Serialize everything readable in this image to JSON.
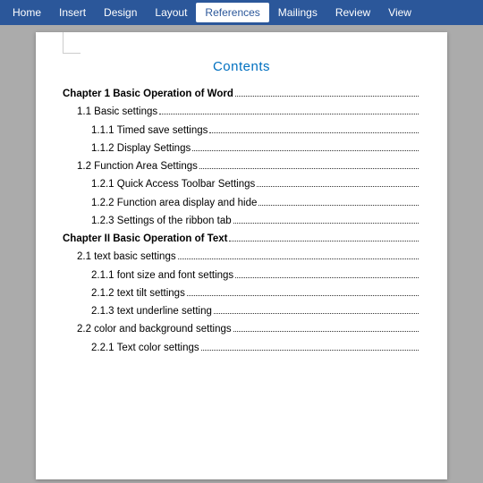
{
  "menuBar": {
    "items": [
      {
        "label": "Home",
        "active": false
      },
      {
        "label": "Insert",
        "active": false
      },
      {
        "label": "Design",
        "active": false
      },
      {
        "label": "Layout",
        "active": false
      },
      {
        "label": "References",
        "active": true
      },
      {
        "label": "Mailings",
        "active": false
      },
      {
        "label": "Review",
        "active": false
      },
      {
        "label": "View",
        "active": false
      }
    ]
  },
  "document": {
    "tocTitle": "Contents",
    "entries": [
      {
        "level": 0,
        "text": "Chapter 1 Basic Operation of Word"
      },
      {
        "level": 1,
        "text": "1.1 Basic settings"
      },
      {
        "level": 2,
        "text": "1.1.1 Timed save settings"
      },
      {
        "level": 2,
        "text": "1.1.2 Display Settings"
      },
      {
        "level": 1,
        "text": "1.2 Function Area Settings"
      },
      {
        "level": 2,
        "text": "1.2.1 Quick Access Toolbar Settings"
      },
      {
        "level": 2,
        "text": "1.2.2 Function area display and hide"
      },
      {
        "level": 2,
        "text": "1.2.3 Settings of the ribbon tab"
      },
      {
        "level": 0,
        "text": "Chapter II Basic Operation of Text"
      },
      {
        "level": 1,
        "text": "2.1 text basic settings"
      },
      {
        "level": 2,
        "text": "2.1.1 font size and font settings"
      },
      {
        "level": 2,
        "text": "2.1.2 text tilt settings"
      },
      {
        "level": 2,
        "text": "2.1.3 text underline setting"
      },
      {
        "level": 1,
        "text": "2.2 color and background settings"
      },
      {
        "level": 2,
        "text": "2.2.1 Text color settings"
      }
    ]
  }
}
